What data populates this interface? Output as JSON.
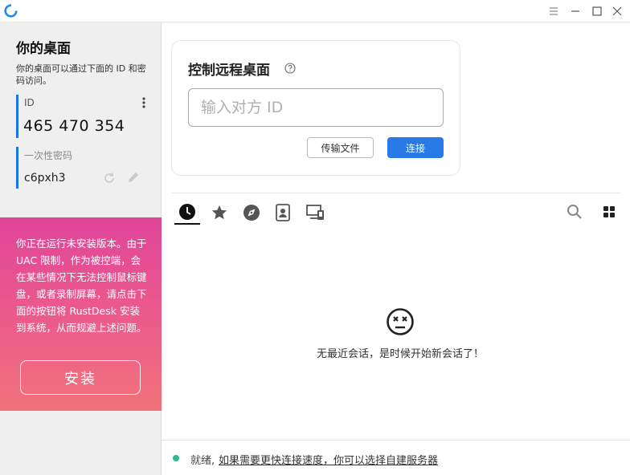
{
  "sidebar": {
    "title": "你的桌面",
    "description": "你的桌面可以通过下面的 ID 和密码访问。",
    "id_label": "ID",
    "id_value": "465 470 354",
    "password_label": "一次性密码",
    "password_value": "c6pxh3",
    "install_notice": "你正在运行未安装版本。由于 UAC 限制，作为被控端，会在某些情况下无法控制鼠标键盘，或者录制屏幕，请点击下面的按钮将 RustDesk 安装到系统，从而规避上述问题。",
    "install_button": "安装"
  },
  "control": {
    "title": "控制远程桌面",
    "id_placeholder": "输入对方 ID",
    "transfer_button": "传输文件",
    "connect_button": "连接"
  },
  "sessions": {
    "empty_text": "无最近会话，是时候开始新会话了！"
  },
  "status": {
    "ready": "就绪,",
    "link": "如果需要更快连接速度，你可以选择自建服务器"
  },
  "colors": {
    "accent": "#2979e6",
    "status_ok": "#2bbb8f",
    "install_gradient_start": "#e0459a",
    "install_gradient_end": "#f2727b"
  }
}
